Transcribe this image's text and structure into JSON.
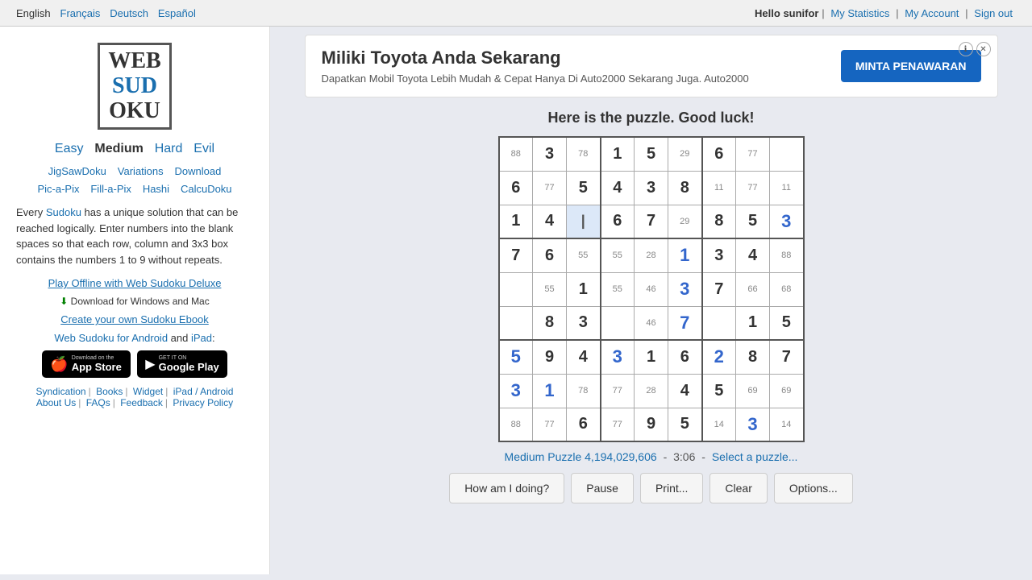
{
  "topbar": {
    "languages": [
      "English",
      "Français",
      "Deutsch",
      "Español"
    ],
    "active_lang": "English",
    "hello_text": "Hello",
    "username": "sunifor",
    "my_statistics": "My Statistics",
    "my_account": "My Account",
    "sign_out": "Sign out"
  },
  "sidebar": {
    "logo_lines": [
      "WEB",
      "SUD",
      "OKU"
    ],
    "difficulty": {
      "easy": "Easy",
      "medium": "Medium",
      "hard": "Hard",
      "evil": "Evil"
    },
    "nav1": [
      "JigSawDoku",
      "Variations",
      "Download"
    ],
    "nav2": [
      "Pic-a-Pix",
      "Fill-a-Pix",
      "Hashi",
      "CalcuDoku"
    ],
    "description": "Every Sudoku has a unique solution that can be reached logically. Enter numbers into the blank spaces so that each row, column and 3x3 box contains the numbers 1 to 9 without repeats.",
    "sudoku_link_text": "Sudoku",
    "offline_link": "Play Offline with Web Sudoku Deluxe",
    "download_hint": "Download for Windows and Mac",
    "ebook_link": "Create your own Sudoku Ebook",
    "android_text": "Web Sudoku for Android",
    "and_text": "and",
    "ipad_text": "iPad",
    "app_store_badge": "Download on the App Store",
    "google_play_badge": "GET IT ON Google Play",
    "footer_links": [
      "Syndication",
      "Books",
      "Widget",
      "iPad / Android",
      "About Us",
      "FAQs",
      "Feedback",
      "Privacy Policy"
    ]
  },
  "ad": {
    "title": "Miliki Toyota Anda Sekarang",
    "description": "Dapatkan Mobil Toyota Lebih Mudah & Cepat Hanya Di Auto2000 Sekarang Juga. Auto2000",
    "button_label": "MINTA PENAWARAN"
  },
  "puzzle": {
    "title": "Here is the puzzle. Good luck!",
    "status": "Medium Puzzle 4,194,029,606",
    "time": "3:06",
    "select_puzzle": "Select a puzzle...",
    "buttons": {
      "how_am_i_doing": "How am I doing?",
      "pause": "Pause",
      "print": "Print...",
      "clear": "Clear",
      "options": "Options..."
    },
    "grid": [
      [
        {
          "main": "88",
          "type": "hint"
        },
        {
          "main": "3",
          "type": "given"
        },
        {
          "main": "78",
          "type": "hint"
        },
        {
          "main": "1",
          "type": "given"
        },
        {
          "main": "5",
          "type": "given"
        },
        {
          "main": "29",
          "type": "hint"
        },
        {
          "main": "6",
          "type": "given"
        },
        {
          "main": "77",
          "type": "hint"
        },
        {
          "main": "",
          "type": "empty"
        }
      ],
      [
        {
          "main": "6",
          "type": "given"
        },
        {
          "main": "77",
          "type": "hint"
        },
        {
          "main": "5",
          "type": "given"
        },
        {
          "main": "4",
          "type": "given"
        },
        {
          "main": "3",
          "type": "given"
        },
        {
          "main": "8",
          "type": "given"
        },
        {
          "main": "11",
          "type": "hint"
        },
        {
          "main": "77",
          "type": "hint"
        },
        {
          "main": "11",
          "type": "hint"
        }
      ],
      [
        {
          "main": "1",
          "type": "given"
        },
        {
          "main": "4",
          "type": "given"
        },
        {
          "main": "",
          "type": "selected"
        },
        {
          "main": "6",
          "type": "given"
        },
        {
          "main": "7",
          "type": "given"
        },
        {
          "main": "29",
          "type": "hint"
        },
        {
          "main": "8",
          "type": "given"
        },
        {
          "main": "5",
          "type": "given"
        },
        {
          "main": "3",
          "type": "user"
        }
      ],
      [
        {
          "main": "7",
          "type": "given"
        },
        {
          "main": "6",
          "type": "given"
        },
        {
          "main": "55",
          "type": "hint"
        },
        {
          "main": "55",
          "type": "hint"
        },
        {
          "main": "28",
          "type": "hint",
          "sub": "/"
        },
        {
          "main": "1",
          "type": "user"
        },
        {
          "main": "3",
          "type": "given"
        },
        {
          "main": "4",
          "type": "given"
        },
        {
          "main": "88",
          "type": "hint"
        }
      ],
      [
        {
          "main": "",
          "type": "empty"
        },
        {
          "main": "55",
          "type": "hint"
        },
        {
          "main": "1",
          "type": "given"
        },
        {
          "main": "55",
          "type": "hint"
        },
        {
          "main": "46",
          "type": "hint"
        },
        {
          "main": "3",
          "type": "user"
        },
        {
          "main": "7",
          "type": "given"
        },
        {
          "main": "66",
          "type": "hint"
        },
        {
          "main": "68",
          "type": "hint"
        }
      ],
      [
        {
          "main": "",
          "type": "empty"
        },
        {
          "main": "8",
          "type": "given"
        },
        {
          "main": "3",
          "type": "given"
        },
        {
          "main": "",
          "type": "empty"
        },
        {
          "main": "46",
          "type": "hint"
        },
        {
          "main": "7",
          "type": "user"
        },
        {
          "main": "",
          "type": "empty"
        },
        {
          "main": "1",
          "type": "given"
        },
        {
          "main": "5",
          "type": "given"
        }
      ],
      [
        {
          "main": "5",
          "type": "user"
        },
        {
          "main": "9",
          "type": "given"
        },
        {
          "main": "4",
          "type": "given"
        },
        {
          "main": "3",
          "type": "user"
        },
        {
          "main": "1",
          "type": "given"
        },
        {
          "main": "6",
          "type": "given"
        },
        {
          "main": "2",
          "type": "user"
        },
        {
          "main": "8",
          "type": "given"
        },
        {
          "main": "7",
          "type": "given"
        }
      ],
      [
        {
          "main": "3",
          "type": "user"
        },
        {
          "main": "1",
          "type": "user"
        },
        {
          "main": "78",
          "type": "hint"
        },
        {
          "main": "77",
          "type": "hint"
        },
        {
          "main": "28",
          "type": "hint",
          "sub": "/"
        },
        {
          "main": "4",
          "type": "given"
        },
        {
          "main": "5",
          "type": "given"
        },
        {
          "main": "69",
          "type": "hint"
        },
        {
          "main": "69",
          "type": "hint"
        }
      ],
      [
        {
          "main": "88",
          "type": "hint"
        },
        {
          "main": "77",
          "type": "hint"
        },
        {
          "main": "6",
          "type": "given"
        },
        {
          "main": "77",
          "type": "hint"
        },
        {
          "main": "9",
          "type": "given"
        },
        {
          "main": "5",
          "type": "given"
        },
        {
          "main": "14",
          "type": "hint"
        },
        {
          "main": "3",
          "type": "user"
        },
        {
          "main": "14",
          "type": "hint"
        }
      ]
    ]
  },
  "footer": {
    "links": [
      "Syndication",
      "Books",
      "Widget",
      "iPad / Android",
      "About Us",
      "FAQs",
      "Feedback",
      "Privacy Policy"
    ]
  }
}
